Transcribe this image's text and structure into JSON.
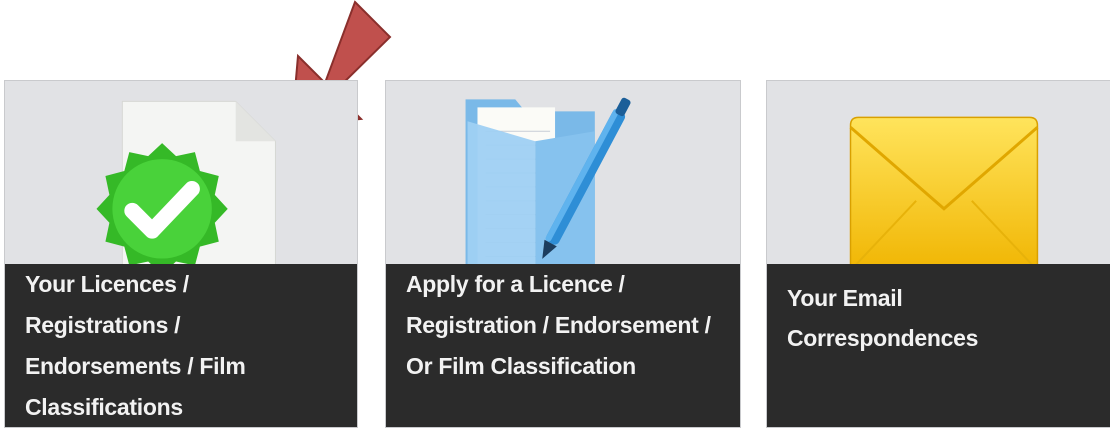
{
  "tiles": [
    {
      "id": "licences",
      "label": "Your Licences / Registrations / Endorsements / Film Classifications",
      "icon": "document-check-icon"
    },
    {
      "id": "apply",
      "label": "Apply for a Licence / Registration / Endorsement / Or Film Classification",
      "icon": "folder-pen-icon"
    },
    {
      "id": "email",
      "label": "Your Email Correspondences",
      "icon": "envelope-icon"
    }
  ],
  "colors": {
    "tile_bg": "#e1e2e5",
    "caption_bg": "#2b2b2b",
    "caption_text": "#f2f2f2",
    "arrow": "#c0504d",
    "check_green": "#3cc42c",
    "folder_blue": "#8fc6ee",
    "envelope_yellow": "#f6c915"
  }
}
